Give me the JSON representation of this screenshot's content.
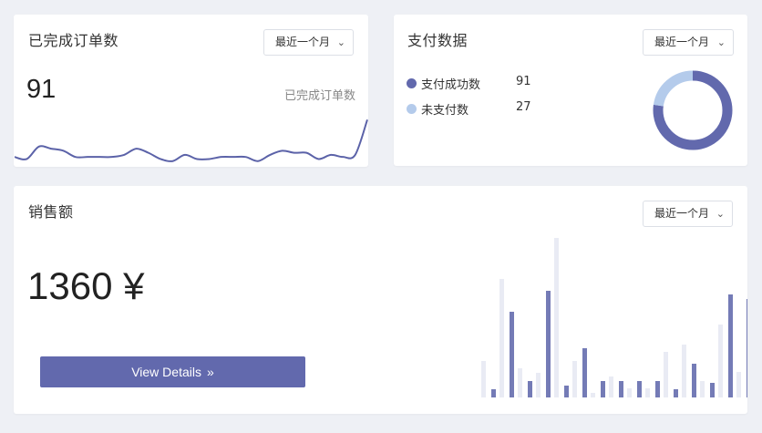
{
  "orders_card": {
    "title": "已完成订单数",
    "select_value": "最近一个月",
    "value": "91",
    "label": "已完成订单数",
    "sparkline": [
      6,
      4,
      16,
      14,
      12,
      6,
      6,
      6,
      6,
      8,
      14,
      10,
      4,
      2,
      8,
      4,
      4,
      6,
      6,
      6,
      2,
      8,
      12,
      10,
      10,
      4,
      8,
      6,
      8,
      42
    ],
    "line_color": "#5b62a8"
  },
  "payment_card": {
    "title": "支付数据",
    "select_value": "最近一个月",
    "items": [
      {
        "label": "支付成功数",
        "value": "91",
        "num": 91,
        "color": "#6269ad"
      },
      {
        "label": "未支付数",
        "value": "27",
        "num": 27,
        "color": "#b4cbeb"
      }
    ]
  },
  "sales_card": {
    "title": "销售额",
    "select_value": "最近一个月",
    "value": "1360 ¥",
    "button_label": "View Details",
    "button_icon": "double-chevron-right-icon",
    "bars": [
      [
        40,
        9
      ],
      [
        130,
        94
      ],
      [
        32,
        18
      ],
      [
        27,
        117
      ],
      [
        175,
        13
      ],
      [
        40,
        54
      ],
      [
        5,
        18
      ],
      [
        23,
        18
      ],
      [
        10,
        18
      ],
      [
        10,
        18
      ],
      [
        50,
        9
      ],
      [
        58,
        37
      ],
      [
        18,
        16
      ],
      [
        80,
        113
      ],
      [
        28,
        108
      ]
    ],
    "bar_color": "#747bb6",
    "bar_light_color": "#e9ebf4"
  }
}
